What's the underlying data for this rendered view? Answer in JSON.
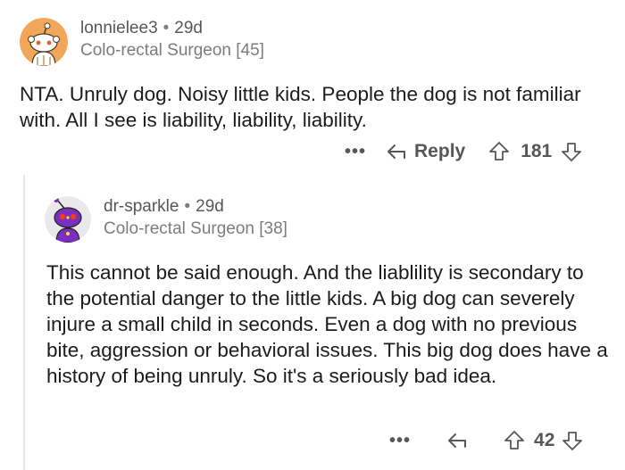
{
  "comments": [
    {
      "username": "lonnielee3",
      "age": "29d",
      "flair": "Colo-rectal Surgeon [45]",
      "body": "NTA. Unruly dog. Noisy little kids. People the dog is not familiar with. All I see is liability, liability, liability.",
      "more_label": "•••",
      "reply_label": "Reply",
      "vote_count": "181"
    },
    {
      "username": "dr-sparkle",
      "age": "29d",
      "flair": "Colo-rectal Surgeon [38]",
      "body": "This cannot be said enough. And the liablility is secondary to the potential danger to the little kids.  A big dog can severely injure a small child in seconds. Even a dog with no previous bite, aggression or behavioral issues. This big dog does have a history of being unruly. So it's a seriously bad idea.",
      "more_label": "•••",
      "vote_count": "42"
    }
  ],
  "meta_separator": "•",
  "colors": {
    "avatar1_bg": "#f2a65a",
    "avatar2_bg": "#e9e9ec",
    "avatar2_accent": "#7b2fbf",
    "meta_text": "#7c7c7c",
    "body_text": "#1c1c1c",
    "action_text": "#575757",
    "thread_line": "#e6e6e6"
  }
}
